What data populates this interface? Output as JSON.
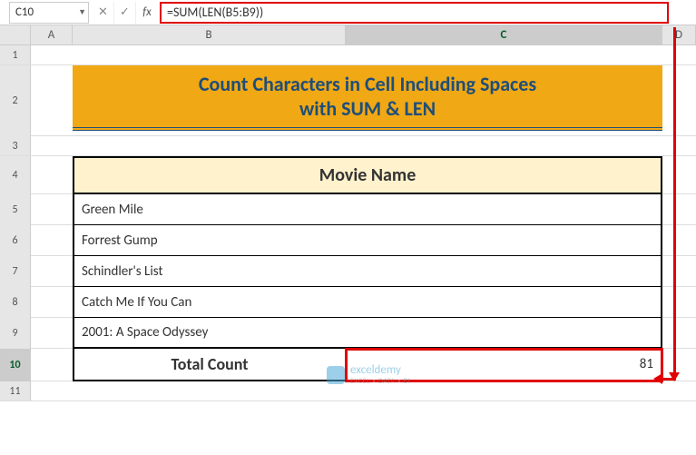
{
  "name_box": "C10",
  "formula": "=SUM(LEN(B5:B9))",
  "columns": {
    "A": "A",
    "B": "B",
    "C": "C",
    "D": "D"
  },
  "rows": {
    "r1": "1",
    "r2": "2",
    "r3": "3",
    "r4": "4",
    "r5": "5",
    "r6": "6",
    "r7": "7",
    "r8": "8",
    "r9": "9",
    "r10": "10",
    "r11": "11"
  },
  "banner": {
    "line1": "Count Characters in Cell Including Spaces",
    "line2": "with SUM & LEN"
  },
  "table": {
    "header": "Movie Name",
    "rows": [
      "Green Mile",
      "Forrest Gump",
      "Schindler's List",
      "Catch  Me If You Can",
      "2001: A Space Odyssey"
    ],
    "total_label": "Total Count",
    "total_value": "81"
  },
  "watermark": {
    "brand": "exceldemy",
    "sub": "EXCEL • DATA • BI"
  },
  "fb_buttons": {
    "cancel": "✕",
    "accept": "✓",
    "fx": "fx"
  },
  "chart_data": {
    "type": "table",
    "title": "Movie Name",
    "categories": [
      "Green Mile",
      "Forrest Gump",
      "Schindler's List",
      "Catch  Me If You Can",
      "2001: A Space Odyssey"
    ],
    "values": [],
    "total_label": "Total Count",
    "total_value": 81,
    "formula": "=SUM(LEN(B5:B9))"
  }
}
